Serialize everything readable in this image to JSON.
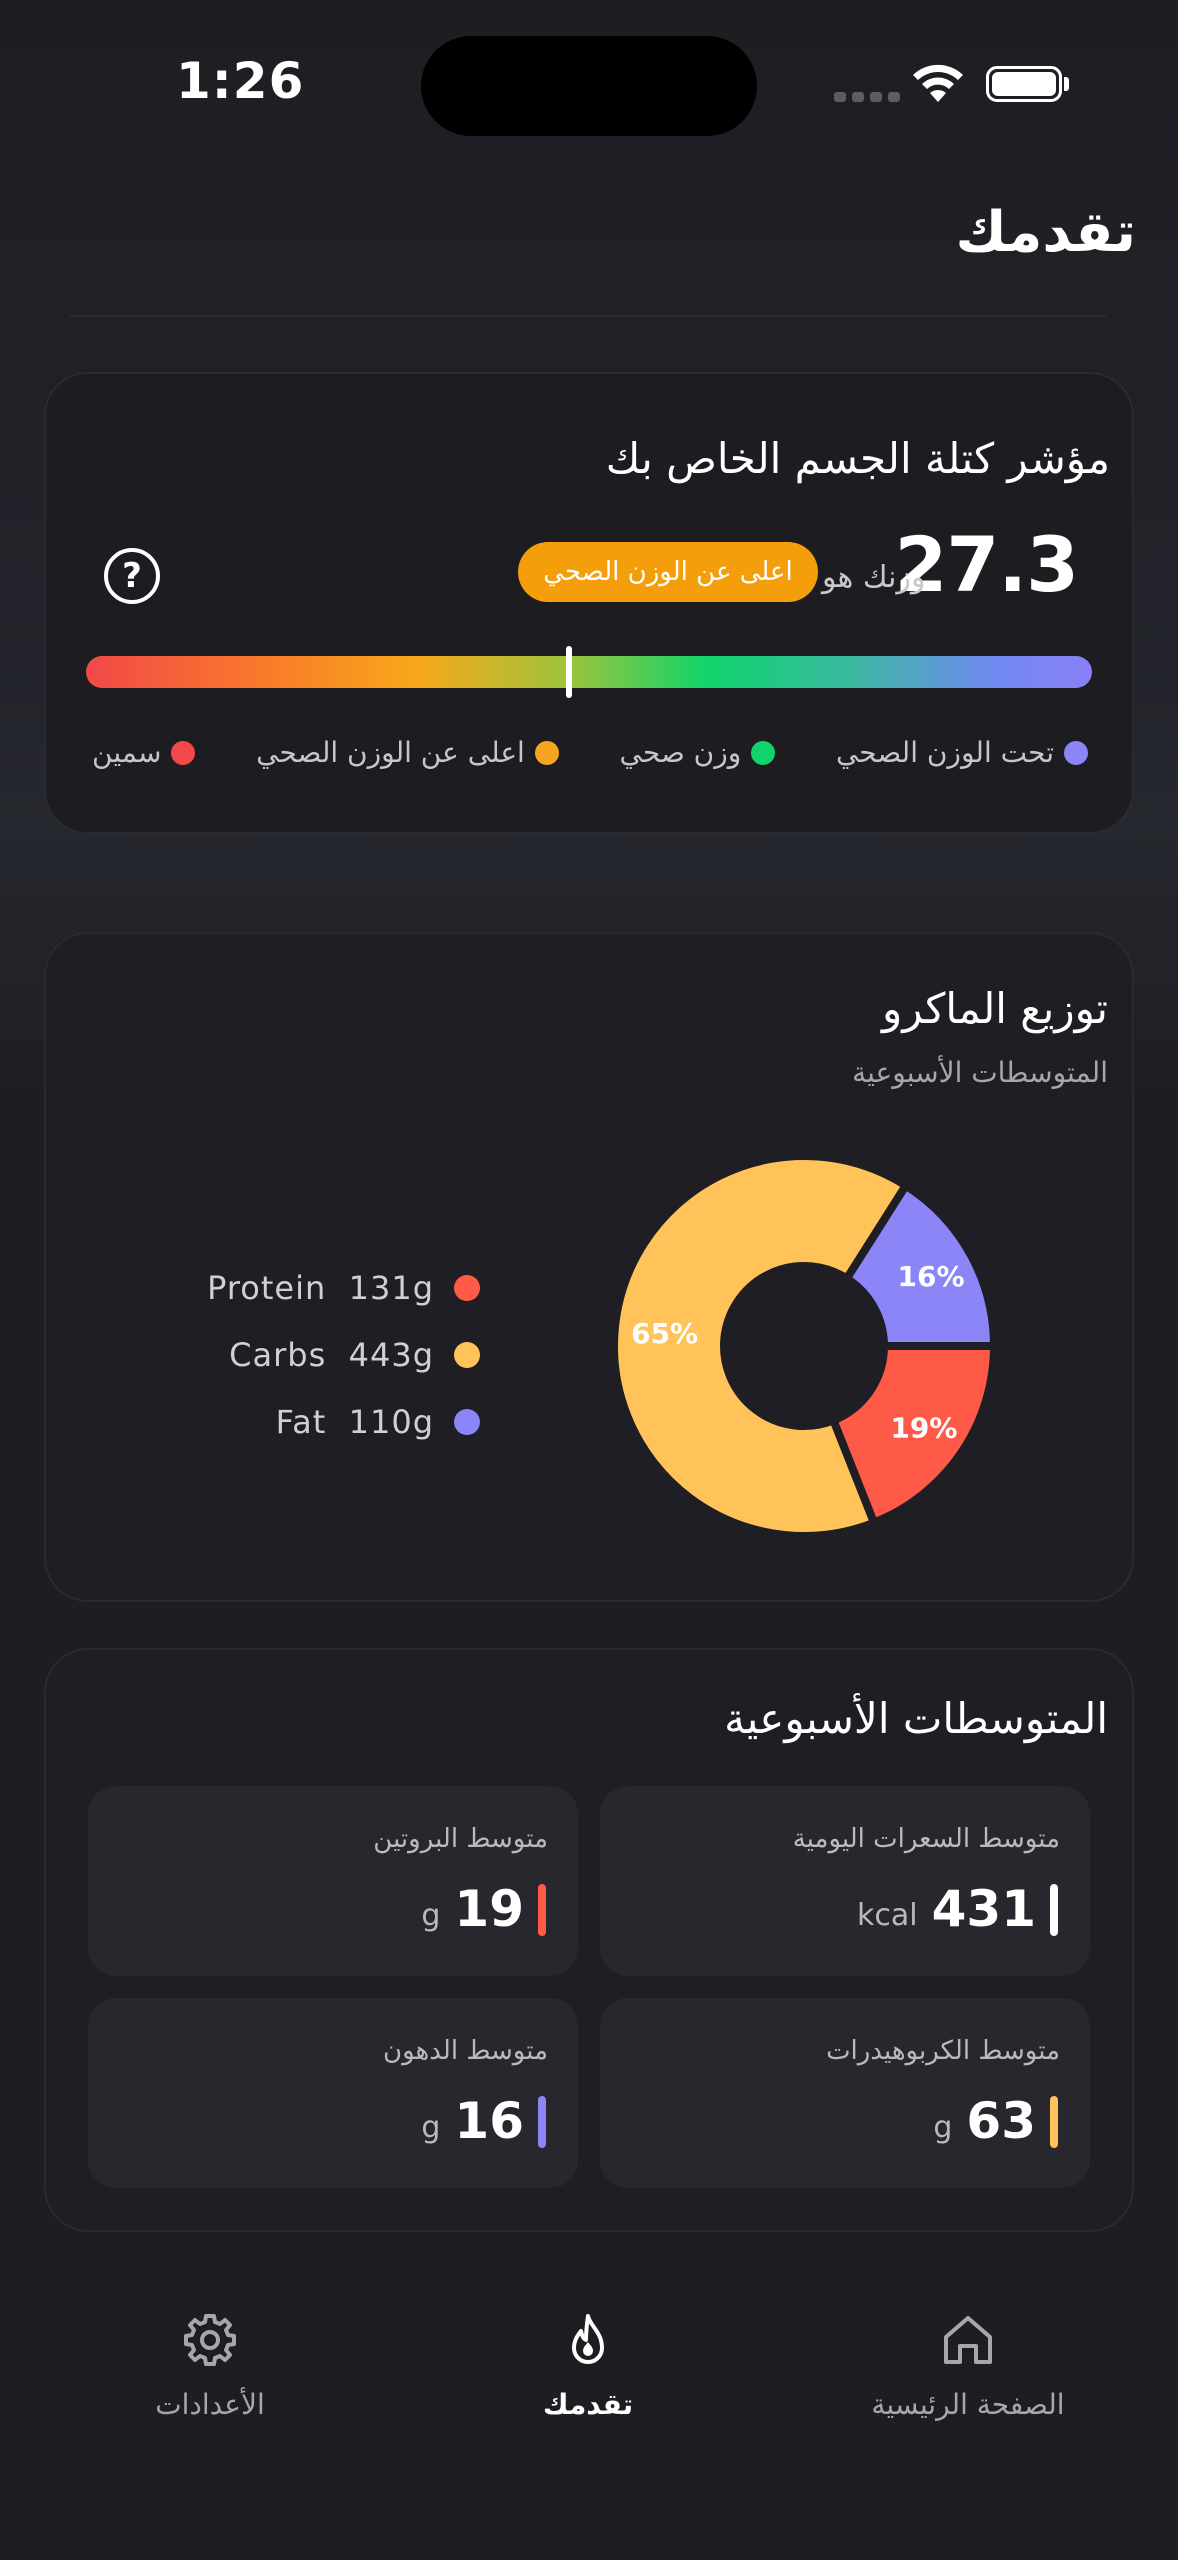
{
  "status_bar": {
    "time": "1:26"
  },
  "page": {
    "title": "تقدمك"
  },
  "bmi": {
    "title": "مؤشر كتلة الجسم الخاص بك",
    "value": "27.3",
    "weight_label": "وزنك هو",
    "badge": "اعلى عن الوزن الصحي",
    "help_icon": "question-circle-icon",
    "marker_fraction": 0.48,
    "legend": [
      {
        "label": "تحت الوزن الصحي",
        "color": "#8b85f7"
      },
      {
        "label": "وزن صحي",
        "color": "#10d36b"
      },
      {
        "label": "اعلى عن الوزن الصحي",
        "color": "#f7a520"
      },
      {
        "label": "سمين",
        "color": "#f24848"
      }
    ]
  },
  "macros": {
    "title": "توزيع الماكرو",
    "subtitle": "المتوسطات الأسبوعية",
    "legend": [
      {
        "name": "Protein",
        "amount": "131g",
        "color": "#ff5a48"
      },
      {
        "name": "Carbs",
        "amount": "443g",
        "color": "#ffc35a"
      },
      {
        "name": "Fat",
        "amount": "110g",
        "color": "#8b85f7"
      }
    ]
  },
  "chart_data": {
    "type": "pie",
    "categories": [
      "Protein",
      "Carbs",
      "Fat"
    ],
    "values": [
      19,
      65,
      16
    ],
    "labels": [
      "19%",
      "65%",
      "16%"
    ],
    "colors": [
      "#ff5a48",
      "#ffc35a",
      "#8b85f7"
    ],
    "donut": true
  },
  "weekly": {
    "title": "المتوسطات الأسبوعية",
    "stats": [
      {
        "label": "متوسط السعرات اليومية",
        "value": "431",
        "unit": "kcal",
        "color": "#ffffff"
      },
      {
        "label": "متوسط البروتين",
        "value": "19",
        "unit": "g",
        "color": "#ff5a48"
      },
      {
        "label": "متوسط الكربوهيدرات",
        "value": "63",
        "unit": "g",
        "color": "#ffc35a"
      },
      {
        "label": "متوسط الدهون",
        "value": "16",
        "unit": "g",
        "color": "#8b85f7"
      }
    ]
  },
  "nav": {
    "home": "الصفحة الرئيسية",
    "progress": "تقدمك",
    "settings": "الأعدادات"
  }
}
